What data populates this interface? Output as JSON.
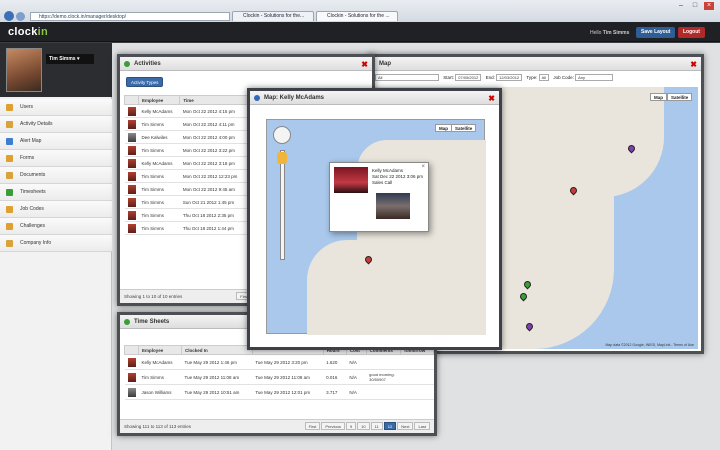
{
  "browser": {
    "url": "https://demo.clock.in/manager/desktop/",
    "tab1": "Clockin - Solutions for the...",
    "tab2": "Clockin - Solutions for the ..."
  },
  "app": {
    "logo_text": "clock",
    "logo_accent": "in",
    "hello_text": "Hello",
    "hello_user": "Tim Simms",
    "save_layout": "Save Layout",
    "logout": "Logout"
  },
  "profile": {
    "name": "Tim Simms"
  },
  "sidebar": {
    "items": [
      {
        "label": "Users",
        "icon": "users-icon",
        "color": "#e0a030"
      },
      {
        "label": "Activity Details",
        "icon": "activity-icon",
        "color": "#d9a23a"
      },
      {
        "label": "Alert Map",
        "icon": "map-icon",
        "color": "#3c7fd1"
      },
      {
        "label": "Forms",
        "icon": "forms-icon",
        "color": "#e0a030"
      },
      {
        "label": "Documents",
        "icon": "documents-icon",
        "color": "#d9a23a"
      },
      {
        "label": "Timesheets",
        "icon": "timesheets-icon",
        "color": "#3a9d3a"
      },
      {
        "label": "Job Codes",
        "icon": "job-codes-icon",
        "color": "#e0a030"
      },
      {
        "label": "Challenges",
        "icon": "challenges-icon",
        "color": "#e0a030"
      },
      {
        "label": "Company Info",
        "icon": "company-icon",
        "color": "#d9a23a"
      }
    ]
  },
  "activities": {
    "title": "Activities",
    "button": "Activity Types",
    "columns": [
      "Employee",
      "Time",
      "Type"
    ],
    "rows": [
      {
        "employee": "Kelly McAdams",
        "time": "Mon Oct 22 2012 4:15 pm"
      },
      {
        "employee": "Tim Simms",
        "time": "Mon Oct 22 2012 4:11 pm"
      },
      {
        "employee": "Dee Kalwiles",
        "time": "Mon Oct 22 2012 4:00 pm"
      },
      {
        "employee": "Tim Simms",
        "time": "Mon Oct 22 2012 3:22 pm"
      },
      {
        "employee": "Kelly McAdams",
        "time": "Mon Oct 22 2012 3:18 pm"
      },
      {
        "employee": "Tim Simms",
        "time": "Mon Oct 22 2012 12:23 pm"
      },
      {
        "employee": "Tim Simms",
        "time": "Mon Oct 22 2012 9:45 am"
      },
      {
        "employee": "Tim Simms",
        "time": "Sun Oct 21 2012 1:45 pm"
      },
      {
        "employee": "Tim Simms",
        "time": "Thu Oct 18 2012 2:35 pm"
      },
      {
        "employee": "Tim Simms",
        "time": "Thu Oct 18 2012 1:44 pm"
      }
    ],
    "footer": "Showing 1 to 10 of 10 entries",
    "first": "First"
  },
  "popup": {
    "title": "Map: Kelly McAdams",
    "map_btn": "Map",
    "sat_btn": "Satellite",
    "info_name": "Kelly McAdams",
    "info_time": "Sat Dec 22 2012 3:06 pm",
    "info_status": "Sales Call"
  },
  "alertmap": {
    "title": "Map",
    "filter1": "All",
    "filter_start_label": "Start:",
    "filter_start": "07/05/2012",
    "filter_end_label": "End:",
    "filter_end": "12/03/2012",
    "filter_type_label": "Type:",
    "filter_type": "All",
    "filter_job_label": "Job Code:",
    "filter_job": "Any",
    "map_btn": "Map",
    "sat_btn": "Satellite",
    "footer": "Map data ©2012 Google, INEGI, MapLink - Terms of Use"
  },
  "timesheets": {
    "title": "Time Sheets",
    "columns": [
      "Employee",
      "Clocked In",
      "",
      "Hours",
      "Cost",
      "Comments",
      "Tomorrow"
    ],
    "rows": [
      {
        "employee": "Kelly McAdams",
        "in": "Tue May 29 2012 1:46 pm",
        "out": "Tue May 29 2012 3:20 pm",
        "hours": "1.620",
        "cost": "N/A",
        "comment": ""
      },
      {
        "employee": "Tim Simms",
        "in": "Tue May 29 2012 11:08 am",
        "out": "Tue May 29 2012 11:08 am",
        "hours": "0.016",
        "cost": "N/A",
        "comment": "good morning. 30/50907"
      },
      {
        "employee": "Jason Williams",
        "in": "Tue May 29 2012 10:51 am",
        "out": "Tue May 29 2012 12:01 pm",
        "hours": "3.717",
        "cost": "N/A",
        "comment": ""
      }
    ],
    "footer": "Showing 111 to 113 of 113 entries",
    "pages": [
      "First",
      "Previous",
      "9",
      "10",
      "11",
      "12",
      "Next",
      "Last"
    ]
  }
}
